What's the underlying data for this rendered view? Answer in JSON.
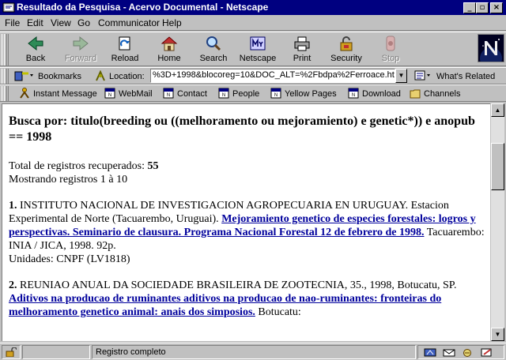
{
  "window": {
    "title": "Resultado da Pesquisa - Acervo Documental - Netscape",
    "controls": {
      "minimize": "_",
      "maximize": "▫",
      "close": "×"
    }
  },
  "menu": [
    {
      "label": "File"
    },
    {
      "label": "Edit"
    },
    {
      "label": "View"
    },
    {
      "label": "Go"
    },
    {
      "label": "Communicator"
    },
    {
      "label": "Help"
    }
  ],
  "navigation": {
    "back": "Back",
    "forward": "Forward",
    "reload": "Reload",
    "home": "Home",
    "search": "Search",
    "netscape": "Netscape",
    "print": "Print",
    "security": "Security",
    "stop": "Stop"
  },
  "location": {
    "bookmarks": "Bookmarks",
    "label": "Location:",
    "url": "%3D+1998&blocoreg=10&DOC_ALT=%2Fbdpa%2Ferroace.html",
    "whats_related": "What's Related"
  },
  "personal": [
    "Instant Message",
    "WebMail",
    "Contact",
    "People",
    "Yellow Pages",
    "Download",
    "Channels"
  ],
  "page": {
    "query_prefix": "Busca por: ",
    "query": "titulo(breeding ou ((melhoramento ou mejoramiento) e genetic*)) e anopub == 1998",
    "total_label": "Total de registros recuperados: ",
    "total_value": "55",
    "showing": "Mostrando registros 1 à 10",
    "records": [
      {
        "number": "1.",
        "author": "INSTITUTO NACIONAL DE INVESTIGACION AGROPECUARIA EN URUGUAY. Estacion Experimental de Norte (Tacuarembo, Uruguai).",
        "title": "Mejoramiento genetico de especies forestales: logros y perspectivas. Seminario de clausura. Programa Nacional Forestal 12 de febrero de 1998.",
        "imprint": "Tacuarembo: INIA / JICA, 1998. 92p.",
        "units": "Unidades: CNPF (LV1818)"
      },
      {
        "number": "2.",
        "author": "REUNIAO ANUAL DA SOCIEDADE BRASILEIRA DE ZOOTECNIA, 35., 1998, Botucatu, SP.",
        "title": "Aditivos na producao de ruminantes aditivos na producao de nao-ruminantes: fronteiras do melhoramento genetico animal: anais dos simposios.",
        "imprint": "Botucatu:",
        "units": ""
      }
    ]
  },
  "status": {
    "text": "Registro completo"
  }
}
